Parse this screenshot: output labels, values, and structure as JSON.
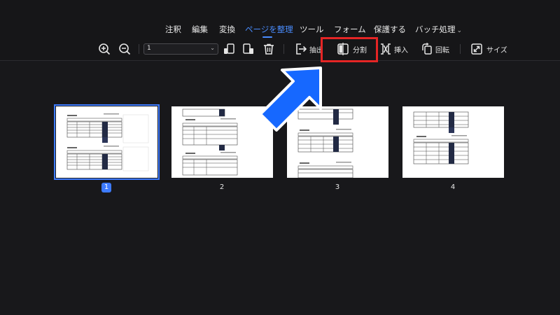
{
  "menu": {
    "items": [
      {
        "label": "注釈",
        "active": false
      },
      {
        "label": "編集",
        "active": false
      },
      {
        "label": "変換",
        "active": false
      },
      {
        "label": "ページを整理",
        "active": true
      },
      {
        "label": "ツール",
        "active": false
      },
      {
        "label": "フォーム",
        "active": false
      },
      {
        "label": "保護する",
        "active": false
      },
      {
        "label": "バッチ処理",
        "active": false
      }
    ],
    "batch_chevron": "⌄"
  },
  "toolbar": {
    "page_select_value": "1",
    "extract_label": "抽出",
    "split_label": "分割",
    "insert_label": "挿入",
    "rotate_label": "回転",
    "size_label": "サイズ"
  },
  "pages": [
    {
      "number": "1",
      "selected": true
    },
    {
      "number": "2",
      "selected": false
    },
    {
      "number": "3",
      "selected": false
    },
    {
      "number": "4",
      "selected": false
    }
  ],
  "colors": {
    "accent": "#4a8dff",
    "highlight": "#e52525",
    "pointer_arrow": "#1668ff"
  }
}
